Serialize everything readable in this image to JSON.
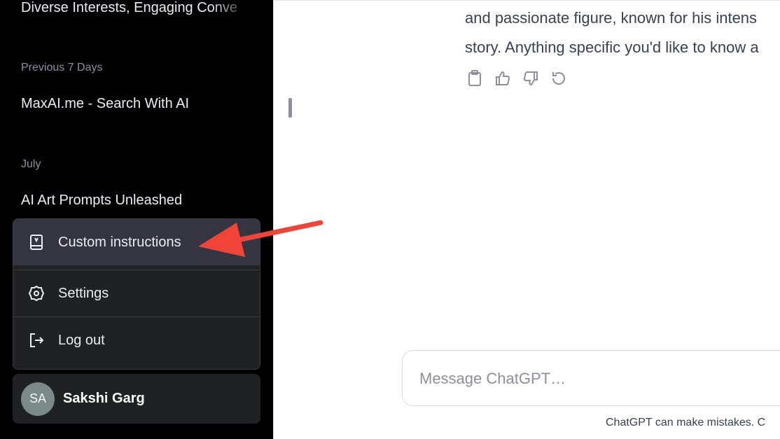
{
  "sidebar": {
    "chats_top": [
      "Diverse Interests, Engaging Conve"
    ],
    "sections": [
      {
        "label": "Previous 7 Days",
        "items": [
          "MaxAI.me - Search With AI"
        ]
      },
      {
        "label": "July",
        "items": [
          "AI Art Prompts Unleashed"
        ]
      }
    ],
    "menu": {
      "custom_instructions": "Custom instructions",
      "settings": "Settings",
      "log_out": "Log out"
    },
    "user": {
      "initials": "SA",
      "name": "Sakshi Garg"
    }
  },
  "main": {
    "reply_lines": [
      "and passionate figure, known for his intens",
      "story. Anything specific you'd like to know a"
    ],
    "actions": [
      "clipboard-icon",
      "thumbs-up-icon",
      "thumbs-down-icon",
      "regenerate-icon"
    ],
    "composer_placeholder": "Message ChatGPT…",
    "disclaimer": "ChatGPT can make mistakes. C"
  },
  "annotation": {
    "arrow_color": "#f04438"
  },
  "colors": {
    "sidebar_bg": "#000000",
    "menu_bg": "#202123",
    "menu_active": "#343541",
    "main_bg": "#ffffff"
  }
}
